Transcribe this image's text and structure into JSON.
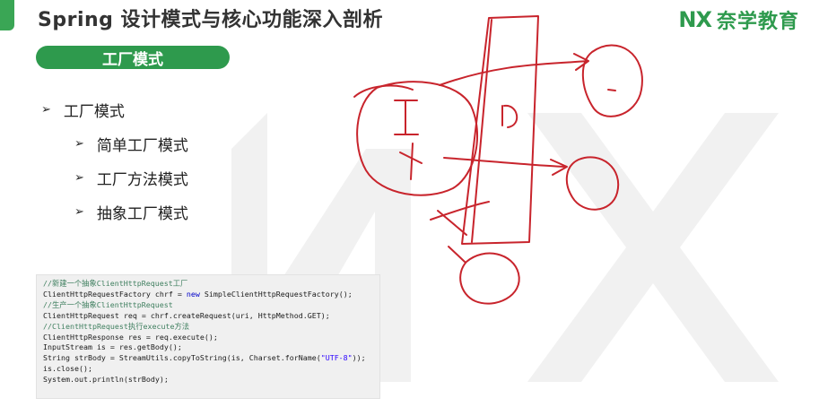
{
  "header": {
    "title": "Spring 设计模式与核心功能深入剖析",
    "brand_mark": "NX",
    "brand_name": "奈学教育",
    "accent_color": "#2e9a4d"
  },
  "section": {
    "label": "工厂模式"
  },
  "bullets": [
    {
      "text": "工厂模式",
      "level": 1
    },
    {
      "text": "简单工厂模式",
      "level": 2
    },
    {
      "text": "工厂方法模式",
      "level": 2
    },
    {
      "text": "抽象工厂模式",
      "level": 2
    }
  ],
  "code": {
    "lines": [
      {
        "type": "comment",
        "text": "//新建一个抽象ClientHttpRequest工厂"
      },
      {
        "type": "code",
        "pre": "ClientHttpRequestFactory chrf = ",
        "kw": "new",
        "post": " SimpleClientHttpRequestFactory();"
      },
      {
        "type": "comment",
        "text": "//生产一个抽象ClientHttpRequest"
      },
      {
        "type": "code",
        "pre": "ClientHttpRequest req = chrf.createRequest(uri, HttpMethod.GET);"
      },
      {
        "type": "comment",
        "text": "//ClientHttpRequest执行execute方法"
      },
      {
        "type": "code",
        "pre": "ClientHttpResponse res = req.execute();"
      },
      {
        "type": "code",
        "pre": "InputStream is = res.getBody();"
      },
      {
        "type": "code",
        "pre": "String strBody = StreamUtils.copyToString(is, Charset.forName(",
        "str": "\"UTF-8\"",
        "post": "));"
      },
      {
        "type": "code",
        "pre": "is.close();"
      },
      {
        "type": "code",
        "pre": "System.out.println(strBody);"
      }
    ]
  },
  "annotation": {
    "ink_color": "#c8242c"
  }
}
